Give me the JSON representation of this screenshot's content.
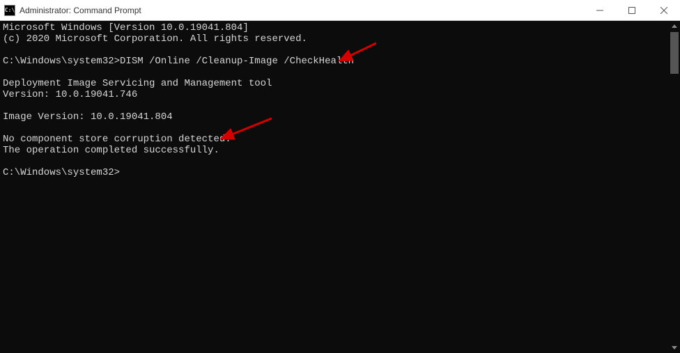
{
  "window": {
    "title": "Administrator: Command Prompt",
    "icon_label": "cmd-icon"
  },
  "terminal": {
    "lines": [
      "Microsoft Windows [Version 10.0.19041.804]",
      "(c) 2020 Microsoft Corporation. All rights reserved.",
      "",
      "C:\\Windows\\system32>DISM /Online /Cleanup-Image /CheckHealth",
      "",
      "Deployment Image Servicing and Management tool",
      "Version: 10.0.19041.746",
      "",
      "Image Version: 10.0.19041.804",
      "",
      "No component store corruption detected.",
      "The operation completed successfully.",
      "",
      "C:\\Windows\\system32>"
    ]
  },
  "annotations": {
    "arrow_color": "#d40000"
  }
}
